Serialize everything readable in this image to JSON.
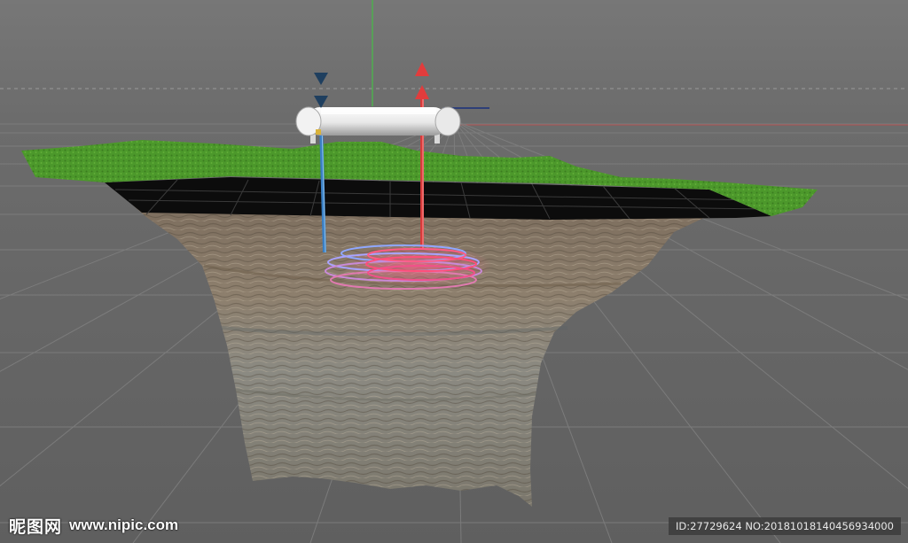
{
  "watermark": {
    "site_name": "昵图网",
    "site_url": "www.nipic.com",
    "image_id_text": "ID:27729624 NO:20181018140456934000"
  },
  "scene": {
    "background_color": "#6f6f6f",
    "grass_color": "#4f9a2c",
    "soil_color": "#8a7a66",
    "injection_pipe_color": "#3a7fc4",
    "extraction_pipe_color": "#d83a3a",
    "inlet_arrow_color": "#1f3f5f",
    "outlet_arrow_color": "#e23c3c"
  }
}
